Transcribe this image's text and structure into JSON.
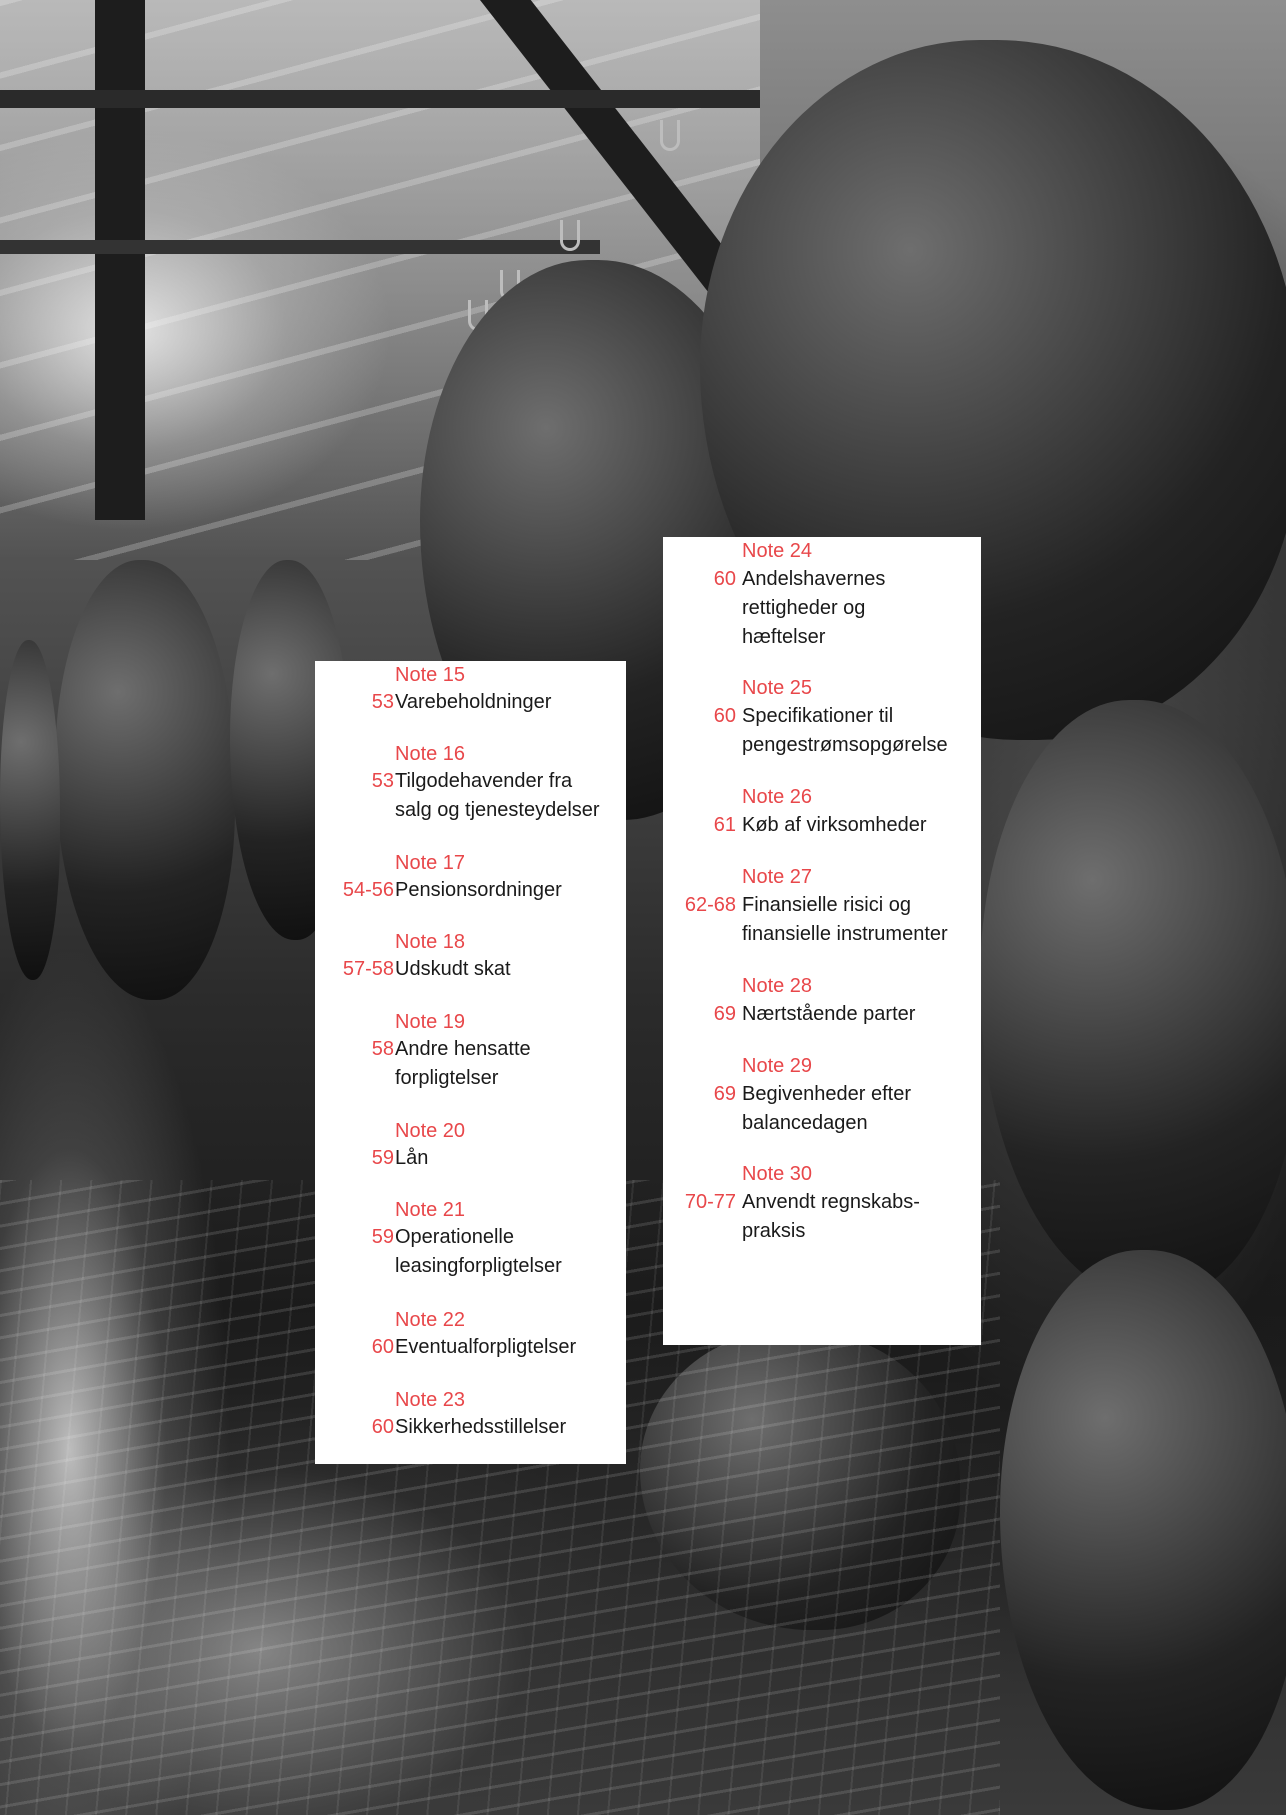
{
  "left_column": [
    {
      "note": "Note 15",
      "pages": "53",
      "title": [
        "Varebeholdninger"
      ]
    },
    {
      "note": "Note 16",
      "pages": "53",
      "title": [
        "Tilgodehavender fra",
        "salg og tjenesteydelser"
      ]
    },
    {
      "note": "Note 17",
      "pages": "54-56",
      "title": [
        "Pensionsordninger"
      ]
    },
    {
      "note": "Note 18",
      "pages": "57-58",
      "title": [
        "Udskudt skat"
      ]
    },
    {
      "note": "Note 19",
      "pages": "58",
      "title": [
        "Andre hensatte",
        "forpligtelser"
      ]
    },
    {
      "note": "Note 20",
      "pages": "59",
      "title": [
        "Lån"
      ]
    },
    {
      "note": "Note 21",
      "pages": "59",
      "title": [
        "Operationelle",
        "leasingforpligtelser"
      ]
    },
    {
      "note": "Note 22",
      "pages": "60",
      "title": [
        "Eventualforpligtelser"
      ]
    },
    {
      "note": "Note 23",
      "pages": "60",
      "title": [
        "Sikkerhedsstillelser"
      ]
    }
  ],
  "right_column": [
    {
      "note": "Note 24",
      "pages": "60",
      "title": [
        "Andelshavernes",
        "rettigheder og",
        "hæftelser"
      ]
    },
    {
      "note": "Note 25",
      "pages": "60",
      "title": [
        "Specifikationer til",
        "pengestrømsopgørelse"
      ]
    },
    {
      "note": "Note 26",
      "pages": "61",
      "title": [
        "Køb af virksomheder"
      ]
    },
    {
      "note": "Note 27",
      "pages": "62-68",
      "title": [
        "Finansielle risici og",
        "finansielle instrumenter"
      ]
    },
    {
      "note": "Note 28",
      "pages": "69",
      "title": [
        "Nærtstående parter"
      ]
    },
    {
      "note": "Note 29",
      "pages": "69",
      "title": [
        "Begivenheder efter",
        "balancedagen"
      ]
    },
    {
      "note": "Note 30",
      "pages": "70-77",
      "title": [
        "Anvendt regnskabs-",
        "praksis"
      ]
    }
  ],
  "colors": {
    "accent": "#e8474a",
    "text": "#1a1a1a",
    "panel": "#ffffff"
  }
}
